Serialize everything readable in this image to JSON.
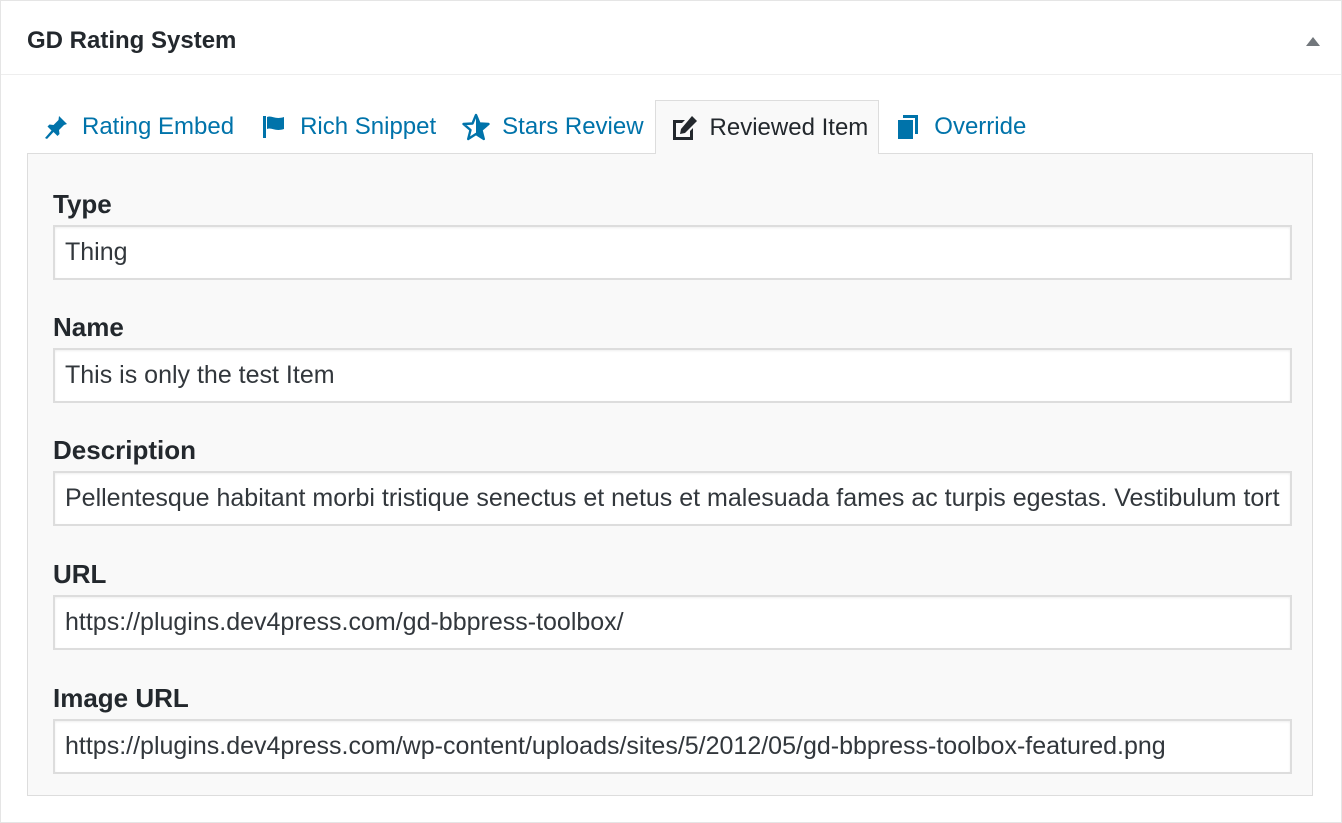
{
  "metabox": {
    "title": "GD Rating System"
  },
  "tabs": [
    {
      "label": "Rating Embed",
      "icon": "pin-icon",
      "active": false
    },
    {
      "label": "Rich Snippet",
      "icon": "flag-icon",
      "active": false
    },
    {
      "label": "Stars Review",
      "icon": "star-icon",
      "active": false
    },
    {
      "label": "Reviewed Item",
      "icon": "edit-icon",
      "active": true
    },
    {
      "label": "Override",
      "icon": "copy-icon",
      "active": false
    }
  ],
  "fields": {
    "type": {
      "label": "Type",
      "value": "Thing"
    },
    "name": {
      "label": "Name",
      "value": "This is only the test Item"
    },
    "description": {
      "label": "Description",
      "value": "Pellentesque habitant morbi tristique senectus et netus et malesuada fames ac turpis egestas. Vestibulum tortor quam, feugiat vitae, ultricies eget, tempor sit amet, ante."
    },
    "url": {
      "label": "URL",
      "value": "https://plugins.dev4press.com/gd-bbpress-toolbox/"
    },
    "image_url": {
      "label": "Image URL",
      "value": "https://plugins.dev4press.com/wp-content/uploads/sites/5/2012/05/gd-bbpress-toolbox-featured.png"
    }
  },
  "colors": {
    "link": "#0073aa",
    "text": "#23282d",
    "icon_muted": "#82878c",
    "panel_bg": "#f9f9f9",
    "border": "#dddddd"
  }
}
